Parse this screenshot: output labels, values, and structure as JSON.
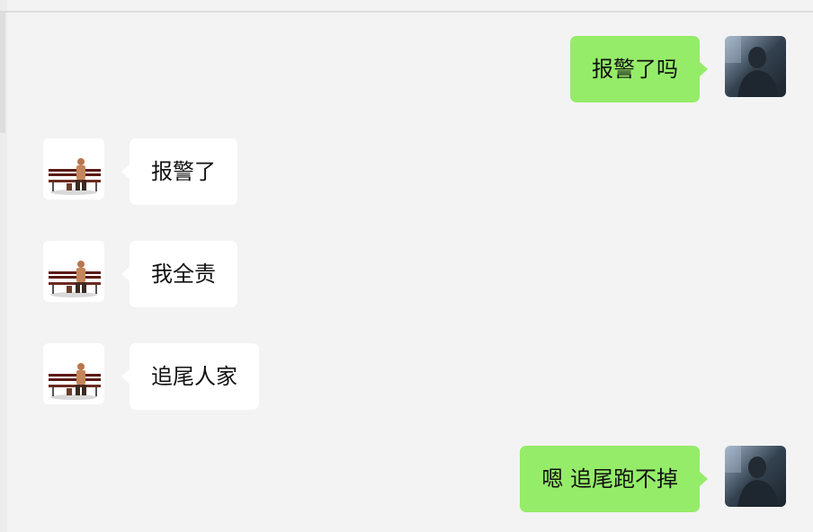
{
  "chat": {
    "messages": [
      {
        "sender": "self",
        "avatar": "dark-photo-avatar",
        "text": "报警了吗"
      },
      {
        "sender": "other",
        "avatar": "bench-figure-avatar",
        "text": "报警了"
      },
      {
        "sender": "other",
        "avatar": "bench-figure-avatar",
        "text": "我全责"
      },
      {
        "sender": "other",
        "avatar": "bench-figure-avatar",
        "text": "追尾人家"
      },
      {
        "sender": "self",
        "avatar": "dark-photo-avatar",
        "text": "嗯 追尾跑不掉"
      }
    ]
  },
  "colors": {
    "background": "#f3f3f3",
    "bubble_self": "#95ec69",
    "bubble_other": "#ffffff",
    "text": "#111111"
  }
}
